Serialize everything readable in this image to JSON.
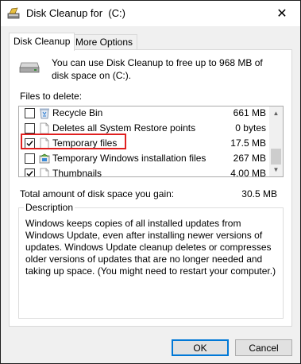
{
  "window": {
    "title": "Disk Cleanup for  (C:)",
    "close_glyph": "✕"
  },
  "tabs": [
    {
      "label": "Disk Cleanup",
      "active": true
    },
    {
      "label": "More Options",
      "active": false
    }
  ],
  "info": {
    "text": "You can use Disk Cleanup to free up to 968 MB of disk space on  (C:)."
  },
  "files_label": "Files to delete:",
  "files": [
    {
      "name": "Recycle Bin",
      "size": "661 MB",
      "checked": false,
      "icon": "recycle-bin-icon"
    },
    {
      "name": "Deletes all System Restore points",
      "size": "0 bytes",
      "checked": false,
      "icon": "document-icon"
    },
    {
      "name": "Temporary files",
      "size": "17.5 MB",
      "checked": true,
      "icon": "document-icon"
    },
    {
      "name": "Temporary Windows installation files",
      "size": "267 MB",
      "checked": false,
      "icon": "windows-setup-icon"
    },
    {
      "name": "Thumbnails",
      "size": "4.00 MB",
      "checked": true,
      "icon": "document-icon"
    }
  ],
  "total": {
    "label": "Total amount of disk space you gain:",
    "value": "30.5 MB"
  },
  "description": {
    "legend": "Description",
    "text": "Windows keeps copies of all installed updates from Windows Update, even after installing newer versions of updates. Windows Update cleanup deletes or compresses older versions of updates that are no longer needed and taking up space. (You might need to restart your computer.)"
  },
  "buttons": {
    "ok": "OK",
    "cancel": "Cancel"
  },
  "colors": {
    "highlight": "#e02020",
    "accent": "#0078d7"
  }
}
